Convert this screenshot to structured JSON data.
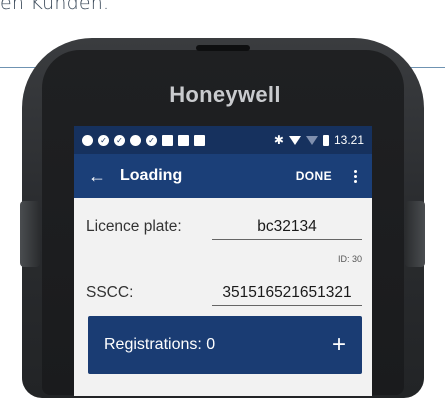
{
  "caption": "en Kunden.",
  "device": {
    "brand": "Honeywell"
  },
  "statusbar": {
    "time": "13.21"
  },
  "appbar": {
    "back": "←",
    "title": "Loading",
    "done": "DONE"
  },
  "form": {
    "licence_label": "Licence plate:",
    "licence_value": "bc32134",
    "id_note": "ID: 30",
    "sscc_label": "SSCC:",
    "sscc_value": "351516521651321"
  },
  "registrations": {
    "label": "Registrations: 0",
    "add": "+"
  },
  "colors": {
    "statusbar": "#16315e",
    "appbar": "#1b3f78",
    "button": "#1a3c73"
  }
}
